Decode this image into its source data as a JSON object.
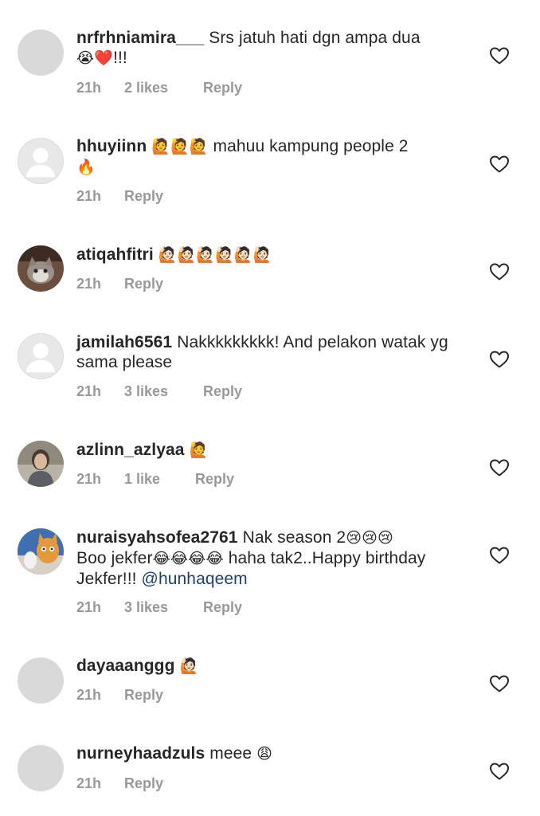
{
  "comments": [
    {
      "username": "nrfrhniamira___",
      "text_parts": [
        "Srs jatuh hati dgn ampa dua",
        "😭❤️",
        "!!!"
      ],
      "time": "21h",
      "likes": "2 likes",
      "reply": "Reply",
      "avatar": "gray-placeholder"
    },
    {
      "username": "hhuyiinn",
      "text_parts": [
        "🙋🙋🙋",
        "mahuu kampung people 2",
        "🔥"
      ],
      "time": "21h",
      "likes": "",
      "reply": "Reply",
      "avatar": "default-user"
    },
    {
      "username": "atiqahfitri",
      "text_parts": [
        "🙋🏻🙋🏻🙋🏻🙋🏻🙋🏻🙋🏻"
      ],
      "time": "21h",
      "likes": "",
      "reply": "Reply",
      "avatar": "cat-photo"
    },
    {
      "username": "jamilah6561",
      "text_parts": [
        "Nakkkkkkkkk! And pelakon watak yg sama please"
      ],
      "time": "21h",
      "likes": "3 likes",
      "reply": "Reply",
      "avatar": "default-user"
    },
    {
      "username": "azlinn_azlyaa",
      "text_parts": [
        "🙋"
      ],
      "time": "21h",
      "likes": "1 like",
      "reply": "Reply",
      "avatar": "person-photo"
    },
    {
      "username": "nuraisyahsofea2761",
      "text_parts": [
        "Nak season 2",
        "😢😢😢",
        "Boo jekfer",
        "😂😂😂😂",
        "haha tak2..Happy birthday Jekfer!!!",
        "@hunhaqeem"
      ],
      "time": "21h",
      "likes": "3 likes",
      "reply": "Reply",
      "avatar": "cartoon-cat"
    },
    {
      "username": "dayaaanggg",
      "text_parts": [
        "🙋🏻"
      ],
      "time": "21h",
      "likes": "",
      "reply": "Reply",
      "avatar": "gray-placeholder"
    },
    {
      "username": "nurneyhaadzuls",
      "text_parts": [
        "meee",
        "😩"
      ],
      "time": "21h",
      "likes": "",
      "reply": "Reply",
      "avatar": "gray-placeholder"
    }
  ],
  "icons": {
    "like": "heart-outline-icon"
  },
  "colors": {
    "username": "#262626",
    "meta": "#999999",
    "mention": "#1d3f73",
    "placeholder": "#d9d9d9"
  }
}
